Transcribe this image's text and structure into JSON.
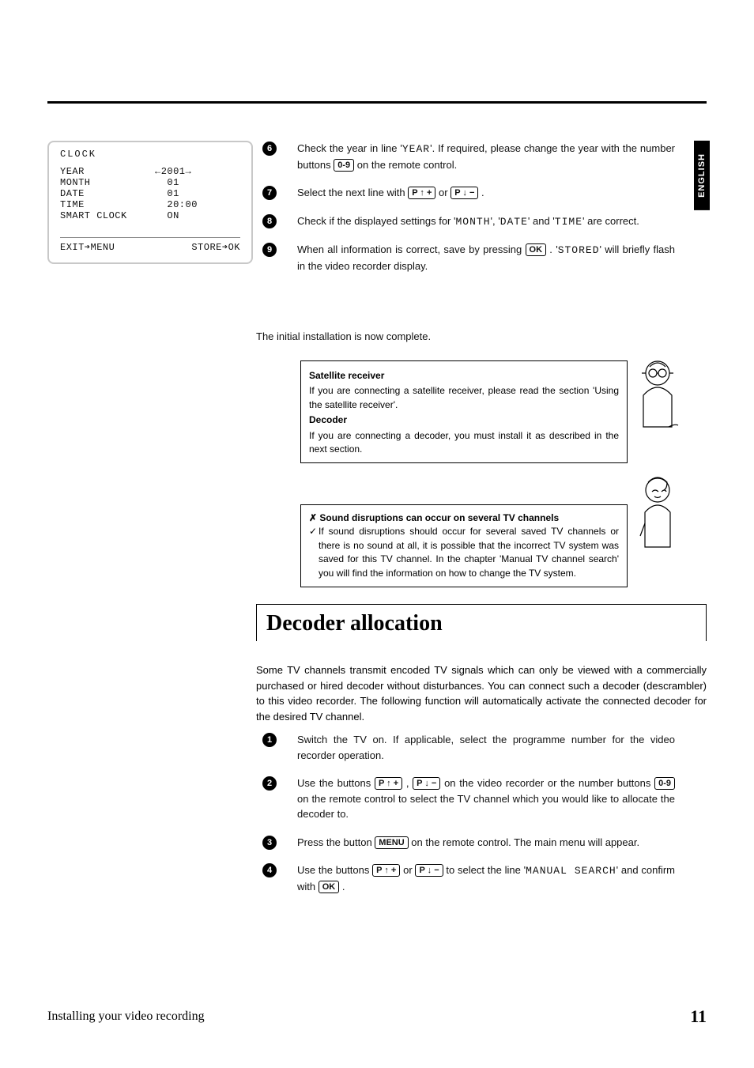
{
  "side_tab": "ENGLISH",
  "clock_panel": {
    "title": "CLOCK",
    "rows": [
      {
        "label": "YEAR",
        "value": "2001",
        "arrows": true
      },
      {
        "label": "MONTH",
        "value": "01"
      },
      {
        "label": "DATE",
        "value": "01"
      },
      {
        "label": "TIME",
        "value": "20:00"
      },
      {
        "label": "SMART CLOCK",
        "value": "ON"
      }
    ],
    "footer_left": "EXIT➔MENU",
    "footer_right": "STORE➔OK"
  },
  "steps_a": [
    {
      "n": "6",
      "html": "Check the year in line '<span class=\"osd\">YEAR</span>'. If required, please change the year with the number buttons <span class=\"btn\">0-9</span> on the remote control."
    },
    {
      "n": "7",
      "html": "Select the next line with <span class=\"btn\">P ↑ +</span> or <span class=\"btn\">P ↓ −</span> ."
    },
    {
      "n": "8",
      "html": "Check if the displayed settings for '<span class=\"osd\">MONTH</span>', '<span class=\"osd\">DATE</span>' and '<span class=\"osd\">TIME</span>' are correct."
    },
    {
      "n": "9",
      "html": "When all information is correct, save by pressing <span class=\"btn\">OK</span> . '<span class=\"osd\">STORED</span>' will briefly flash in the video recorder display."
    }
  ],
  "install_complete": "The initial installation is now complete.",
  "info1": {
    "h1": "Satellite receiver",
    "p1": "If you are connecting a satellite receiver, please read the section 'Using the satellite receiver'.",
    "h2": "Decoder",
    "p2": "If you are connecting a decoder, you must install it as described in the next section."
  },
  "info2": {
    "h": "Sound disruptions can occur on several TV channels",
    "p": "If sound disruptions should occur for several saved TV channels or there is no sound at all, it is possible that the incorrect TV system was saved for this TV channel. In the chapter 'Manual TV channel search' you will find the information on how to change the TV system."
  },
  "section_title": "Decoder allocation",
  "decoder_intro": "Some TV channels transmit encoded TV signals which can only be viewed with a commercially purchased or hired decoder without disturbances. You can connect such a decoder (descrambler) to this video recorder. The following function will automatically activate the connected decoder for the desired TV channel.",
  "steps_b": [
    {
      "n": "1",
      "html": "Switch the TV on. If applicable, select the programme number for the video recorder operation."
    },
    {
      "n": "2",
      "html": "Use the buttons <span class=\"btn\">P ↑ +</span> , <span class=\"btn\">P ↓ −</span> on the video recorder or the number buttons <span class=\"btn\">0-9</span> on the remote control to select the TV channel which you would like to allocate the decoder to."
    },
    {
      "n": "3",
      "html": "Press the button <span class=\"btn\">MENU</span> on the remote control. The main menu will appear."
    },
    {
      "n": "4",
      "html": "Use the buttons <span class=\"btn\">P ↑ +</span> or <span class=\"btn\">P ↓ −</span> to select the line '<span class=\"osd\">MANUAL SEARCH</span>' and confirm with <span class=\"btn\">OK</span> ."
    }
  ],
  "footer": {
    "left": "Installing your video recording",
    "page": "11"
  }
}
